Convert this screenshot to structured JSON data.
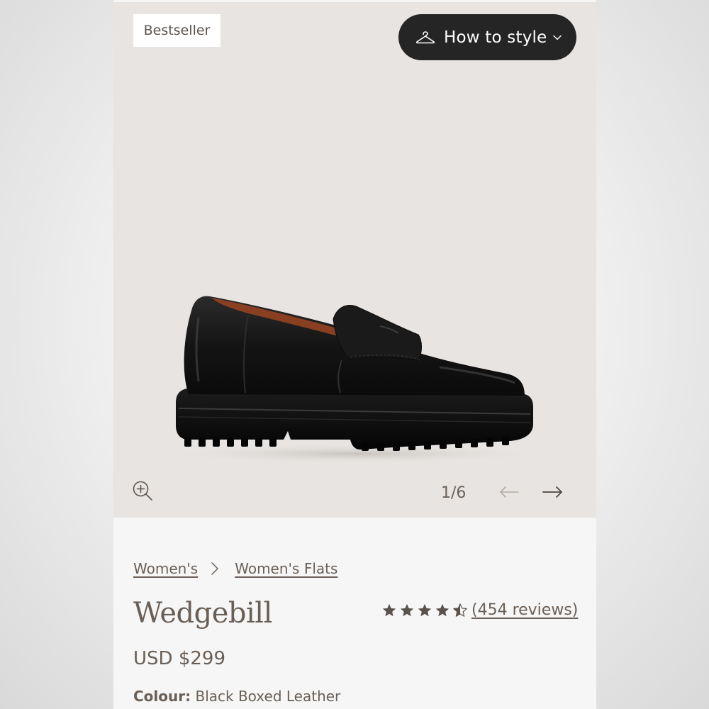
{
  "gallery": {
    "badge": "Bestseller",
    "how_to_style_label": "How to style",
    "counter": "1/6"
  },
  "breadcrumb": {
    "items": [
      "Women's",
      "Women's Flats"
    ]
  },
  "product": {
    "name": "Wedgebill",
    "price": "USD $299",
    "colour_label": "Colour:",
    "colour_value": "Black Boxed Leather",
    "rating_stars": 4.5,
    "reviews_label": "(454 reviews)"
  },
  "icons": {
    "style": "hanger-icon",
    "zoom": "zoom-in-icon",
    "prev": "arrow-left-icon",
    "next": "arrow-right-icon",
    "separator": "chevron-right-icon",
    "rating": "star-icon"
  },
  "colors": {
    "gallery_bg": "#e7e4e1",
    "button_bg": "#252525",
    "text_brown": "#6a5f56",
    "star": "#5a534d"
  }
}
